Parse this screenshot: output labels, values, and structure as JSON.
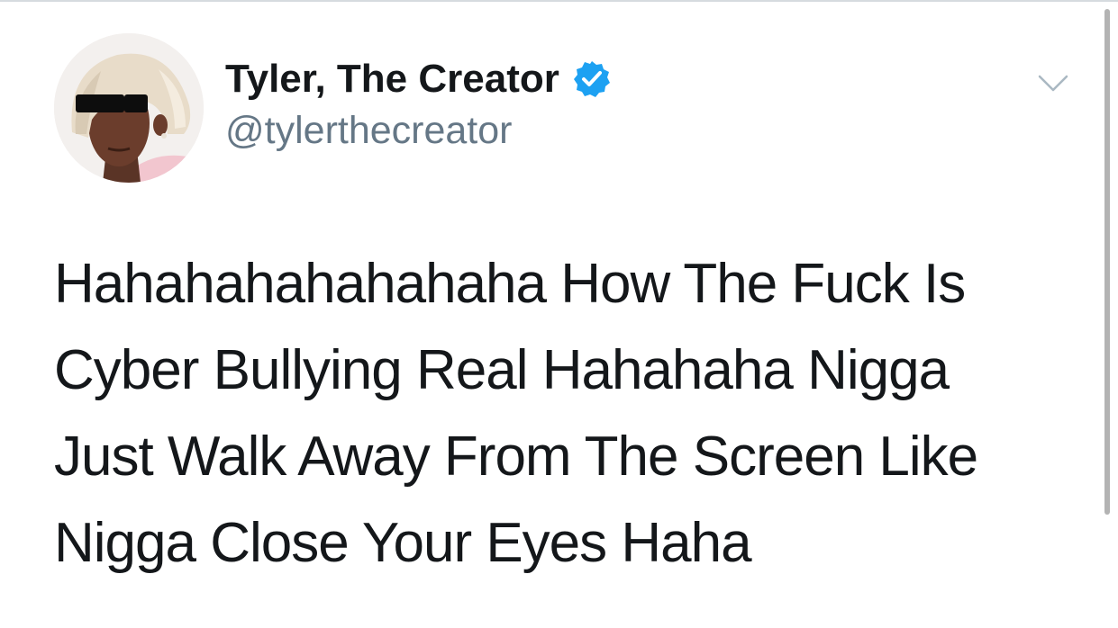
{
  "tweet": {
    "author": {
      "display_name": "Tyler, The Creator",
      "handle": "@tylerthecreator",
      "verified": true,
      "avatar_icon": "profile-photo"
    },
    "lines": [
      "Hahahahahahahaha How The Fuck Is",
      "Cyber Bullying Real Hahahaha Nigga",
      "Just Walk Away From The Screen Like",
      "Nigga Close Your Eyes Haha"
    ]
  },
  "icons": {
    "verified": "verified-badge-icon",
    "menu": "chevron-down-icon"
  },
  "colors": {
    "text": "#14171a",
    "secondary_text": "#657786",
    "verified_blue": "#1da1f2",
    "caret": "#aab8c2"
  }
}
